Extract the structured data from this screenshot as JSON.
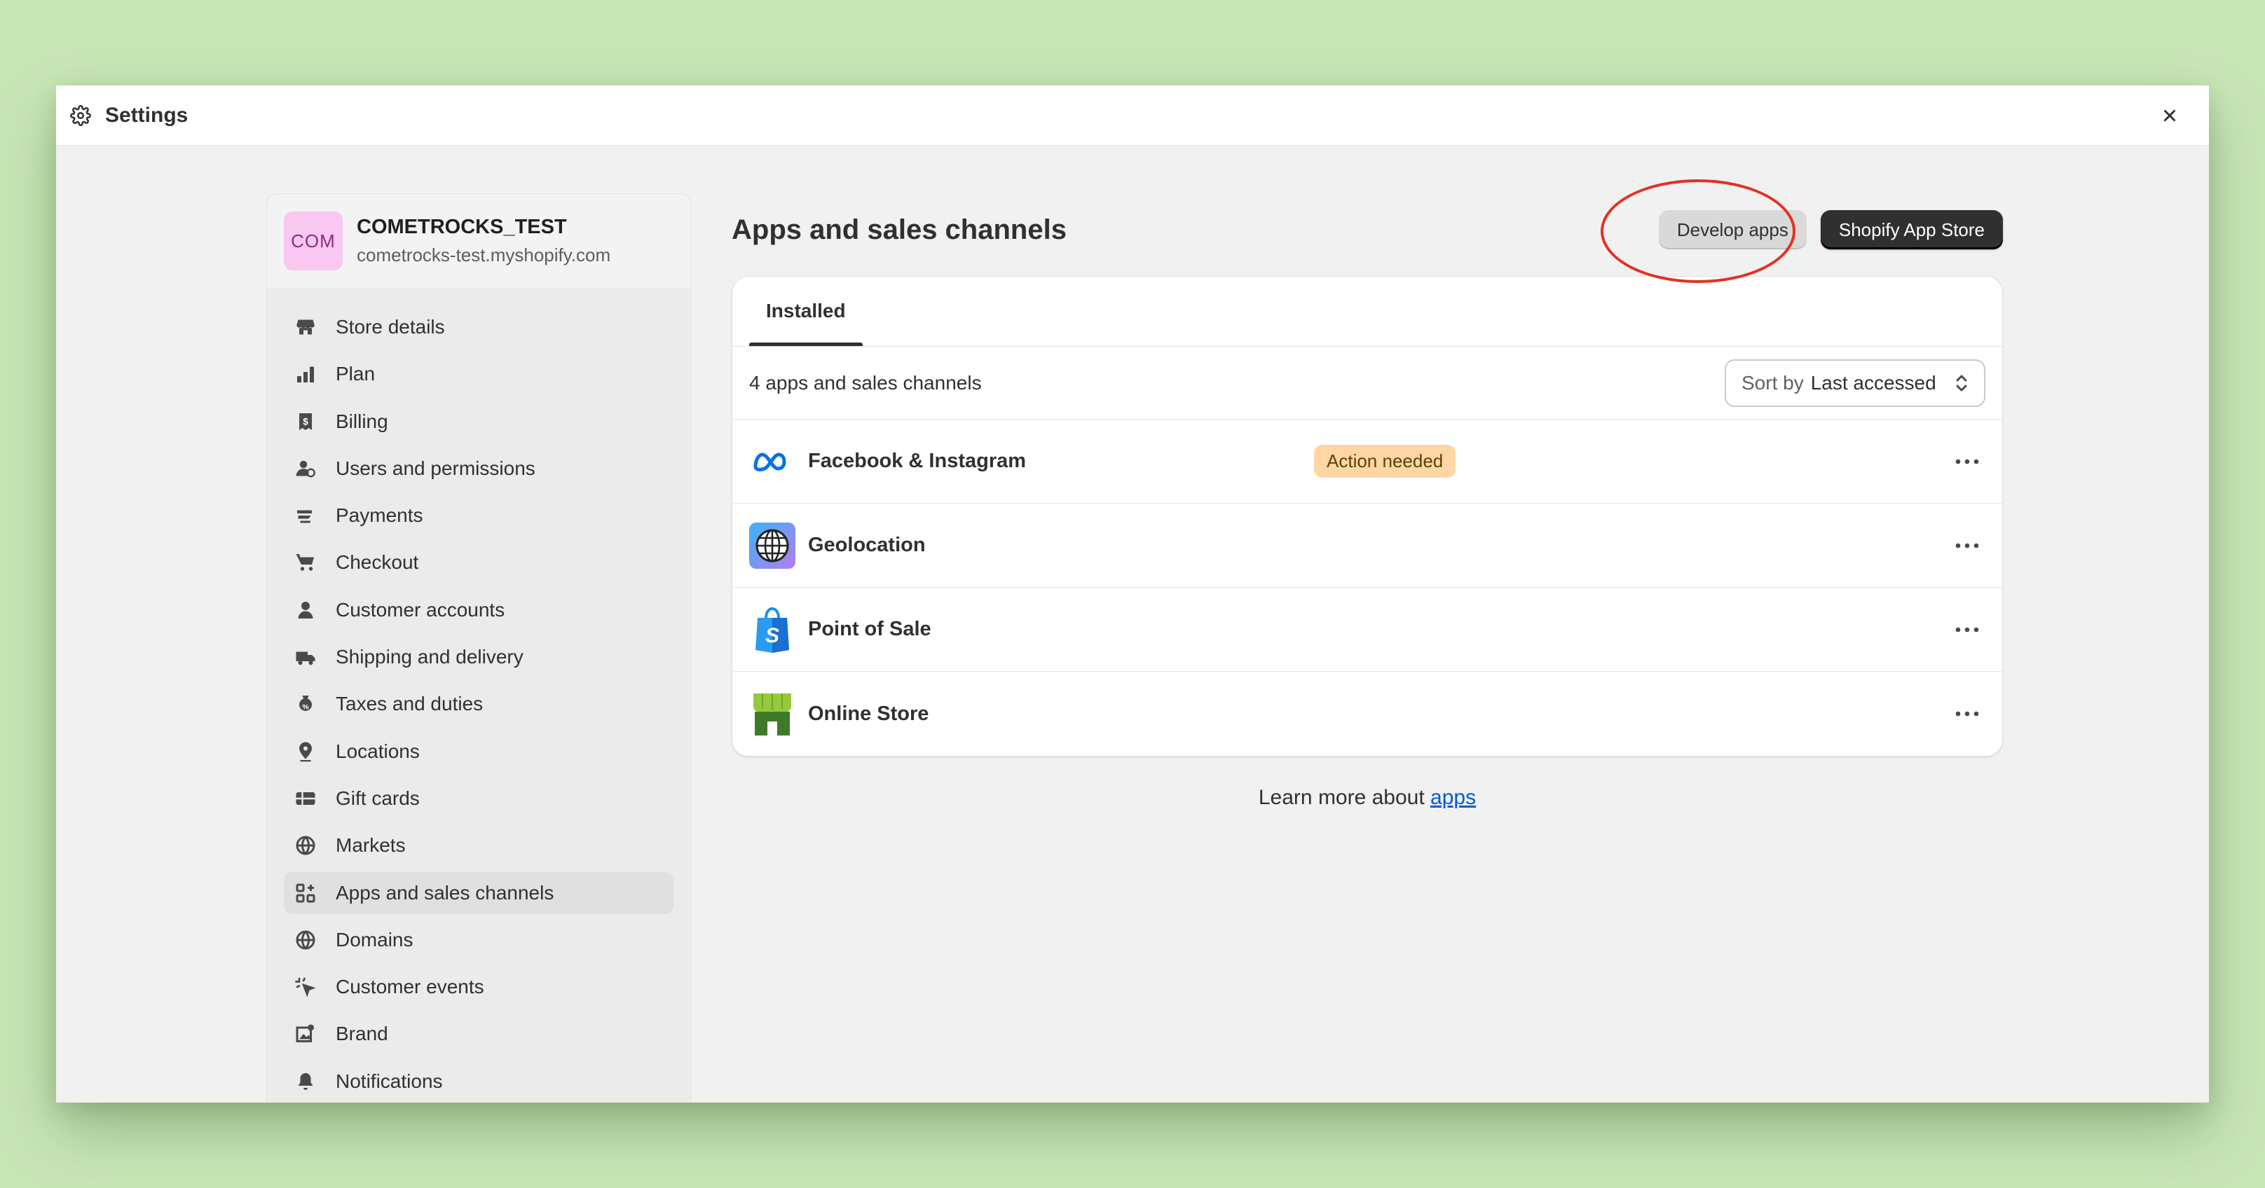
{
  "window": {
    "title": "Settings"
  },
  "store": {
    "avatar_text": "COM",
    "name": "COMETROCKS_TEST",
    "domain": "cometrocks-test.myshopify.com"
  },
  "sidebar": {
    "items": [
      {
        "label": "Store details",
        "icon": "store-icon"
      },
      {
        "label": "Plan",
        "icon": "plan-icon"
      },
      {
        "label": "Billing",
        "icon": "billing-icon"
      },
      {
        "label": "Users and permissions",
        "icon": "users-icon"
      },
      {
        "label": "Payments",
        "icon": "payments-icon"
      },
      {
        "label": "Checkout",
        "icon": "cart-icon"
      },
      {
        "label": "Customer accounts",
        "icon": "person-icon"
      },
      {
        "label": "Shipping and delivery",
        "icon": "truck-icon"
      },
      {
        "label": "Taxes and duties",
        "icon": "tax-icon"
      },
      {
        "label": "Locations",
        "icon": "location-icon"
      },
      {
        "label": "Gift cards",
        "icon": "gift-card-icon"
      },
      {
        "label": "Markets",
        "icon": "globe-icon"
      },
      {
        "label": "Apps and sales channels",
        "icon": "apps-icon",
        "active": true
      },
      {
        "label": "Domains",
        "icon": "domains-icon"
      },
      {
        "label": "Customer events",
        "icon": "cursor-icon"
      },
      {
        "label": "Brand",
        "icon": "brand-icon"
      },
      {
        "label": "Notifications",
        "icon": "bell-icon"
      }
    ]
  },
  "main": {
    "title": "Apps and sales channels",
    "develop_apps_label": "Develop apps",
    "app_store_label": "Shopify App Store",
    "tab_installed": "Installed",
    "count_text": "4 apps and sales channels",
    "sort_label": "Sort by",
    "sort_value": "Last accessed",
    "apps": [
      {
        "name": "Facebook & Instagram",
        "icon": "meta-icon",
        "badge": "Action needed"
      },
      {
        "name": "Geolocation",
        "icon": "globe-app-icon"
      },
      {
        "name": "Point of Sale",
        "icon": "shopify-bag-icon"
      },
      {
        "name": "Online Store",
        "icon": "online-store-icon"
      }
    ],
    "learn_more_prefix": "Learn more about",
    "learn_more_link": "apps"
  },
  "colors": {
    "background": "#c9e6b7",
    "badge_bg": "#ffd6a4",
    "highlight_ring": "#e53022",
    "link": "#005bd3",
    "primary_button": "#303030"
  }
}
